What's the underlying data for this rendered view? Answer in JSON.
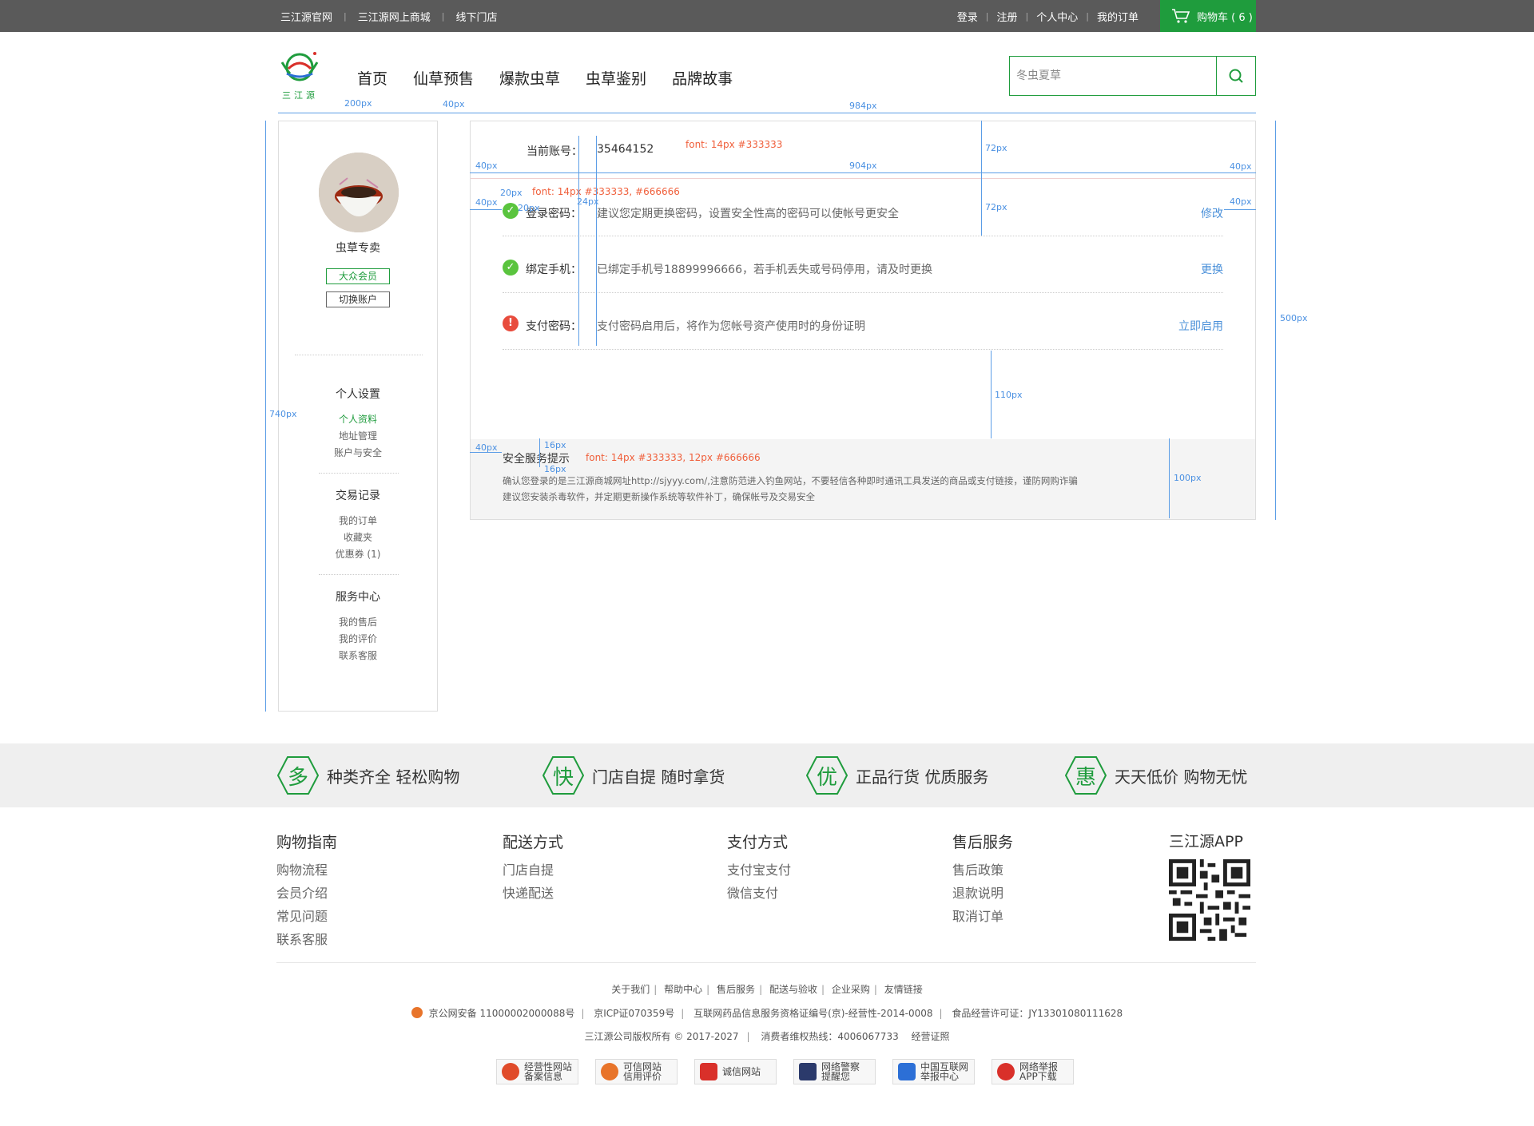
{
  "topbar": {
    "left_links": [
      "三江源官网",
      "三江源网上商城",
      "线下门店"
    ],
    "right_links": [
      "登录",
      "注册",
      "个人中心",
      "我的订单"
    ],
    "cart_label": "购物车 ( 6 )"
  },
  "header": {
    "logo_text": "三江源",
    "nav": [
      "首页",
      "仙草预售",
      "爆款虫草",
      "虫草鉴别",
      "品牌故事"
    ],
    "search_placeholder": "冬虫夏草"
  },
  "sidebar": {
    "username": "虫草专卖",
    "member_badge": "大众会员",
    "switch_account": "切换账户",
    "sections": [
      {
        "title": "个人设置",
        "items": [
          "个人资料",
          "地址管理",
          "账户与安全"
        ]
      },
      {
        "title": "交易记录",
        "items": [
          "我的订单",
          "收藏夹",
          "优惠券 (1)"
        ]
      },
      {
        "title": "服务中心",
        "items": [
          "我的售后",
          "我的评价",
          "联系客服"
        ]
      }
    ]
  },
  "account": {
    "label": "当前账号：",
    "value": "35464152"
  },
  "security_rows": [
    {
      "label": "登录密码：",
      "desc": "建议您定期更换密码，设置安全性高的密码可以使帐号更安全",
      "action": "修改",
      "status": "ok"
    },
    {
      "label": "绑定手机：",
      "desc": "已绑定手机号18899996666，若手机丢失或号码停用，请及时更换",
      "action": "更换",
      "status": "ok"
    },
    {
      "label": "支付密码：",
      "desc": "支付密码启用后，将作为您帐号资产使用时的身份证明",
      "action": "立即启用",
      "status": "warn"
    }
  ],
  "safety_tip": {
    "title": "安全服务提示",
    "line1": "确认您登录的是三江源商城网址http://sjyyy.com/,注意防范进入钓鱼网站，不要轻信各种即时通讯工具发送的商品或支付链接，谨防网购诈骗",
    "line2": "建议您安装杀毒软件，并定期更新操作系统等软件补丁，确保帐号及交易安全"
  },
  "annotations": {
    "w200": "200px",
    "w40a": "40px",
    "w984": "984px",
    "h740": "740px",
    "font1": "font: 14px  #333333",
    "h72a": "72px",
    "w40b": "40px",
    "w904": "904px",
    "w40c": "40px",
    "w20": "20px",
    "font2": "font: 14px  #333333,  #666666",
    "w40d": "40px",
    "h20": "20px",
    "w24": "24px",
    "h72b": "72px",
    "w40e": "40px",
    "h500": "500px",
    "h110": "110px",
    "w40f": "40px",
    "h16a": "16px",
    "h16b": "16px",
    "font3": "font: 14px  #333333,  12px  #666666",
    "h100": "100px"
  },
  "features": [
    {
      "char": "多",
      "text": "种类齐全  轻松购物"
    },
    {
      "char": "快",
      "text": "门店自提   随时拿货"
    },
    {
      "char": "优",
      "text": "正品行货   优质服务"
    },
    {
      "char": "惠",
      "text": "天天低价   购物无忧"
    }
  ],
  "footer": {
    "columns": [
      {
        "title": "购物指南",
        "items": [
          "购物流程",
          "会员介绍",
          "常见问题",
          "联系客服"
        ]
      },
      {
        "title": "配送方式",
        "items": [
          "门店自提",
          "快递配送"
        ]
      },
      {
        "title": "支付方式",
        "items": [
          "支付宝支付",
          "微信支付"
        ]
      },
      {
        "title": "售后服务",
        "items": [
          "售后政策",
          "退款说明",
          "取消订单"
        ]
      }
    ],
    "app_title": "三江源APP",
    "links": [
      "关于我们",
      "帮助中心",
      "售后服务",
      "配送与验收",
      "企业采购",
      "友情链接"
    ],
    "license": [
      "京公网安备 11000002000088号",
      "京ICP证070359号",
      "互联网药品信息服务资格证编号(京)-经营性-2014-0008",
      "食品经营许可证：JY13301080111628"
    ],
    "copyright": "三江源公司版权所有 © 2017-2027",
    "hotline": "消费者维权热线：4006067733",
    "cert_link": "经营证照",
    "certs": [
      {
        "l1": "经营性网站",
        "l2": "备案信息",
        "color": "#e04b2a"
      },
      {
        "l1": "可信网站",
        "l2": "信用评价",
        "color": "#e8742a"
      },
      {
        "l1": "诚信网站",
        "l2": "",
        "color": "#d9302a"
      },
      {
        "l1": "网络警察",
        "l2": "提醒您",
        "color": "#2b3a6b"
      },
      {
        "l1": "中国互联网",
        "l2": "举报中心",
        "color": "#2c6fd6"
      },
      {
        "l1": "网络举报",
        "l2": "APP下载",
        "color": "#d9302a"
      }
    ]
  },
  "colors": {
    "brand_green": "#1f9c3d",
    "link_blue": "#4a90d9",
    "warn_red": "#e84c3d",
    "annotation_blue": "#5b9de6",
    "annotation_orange": "#f0603c"
  }
}
